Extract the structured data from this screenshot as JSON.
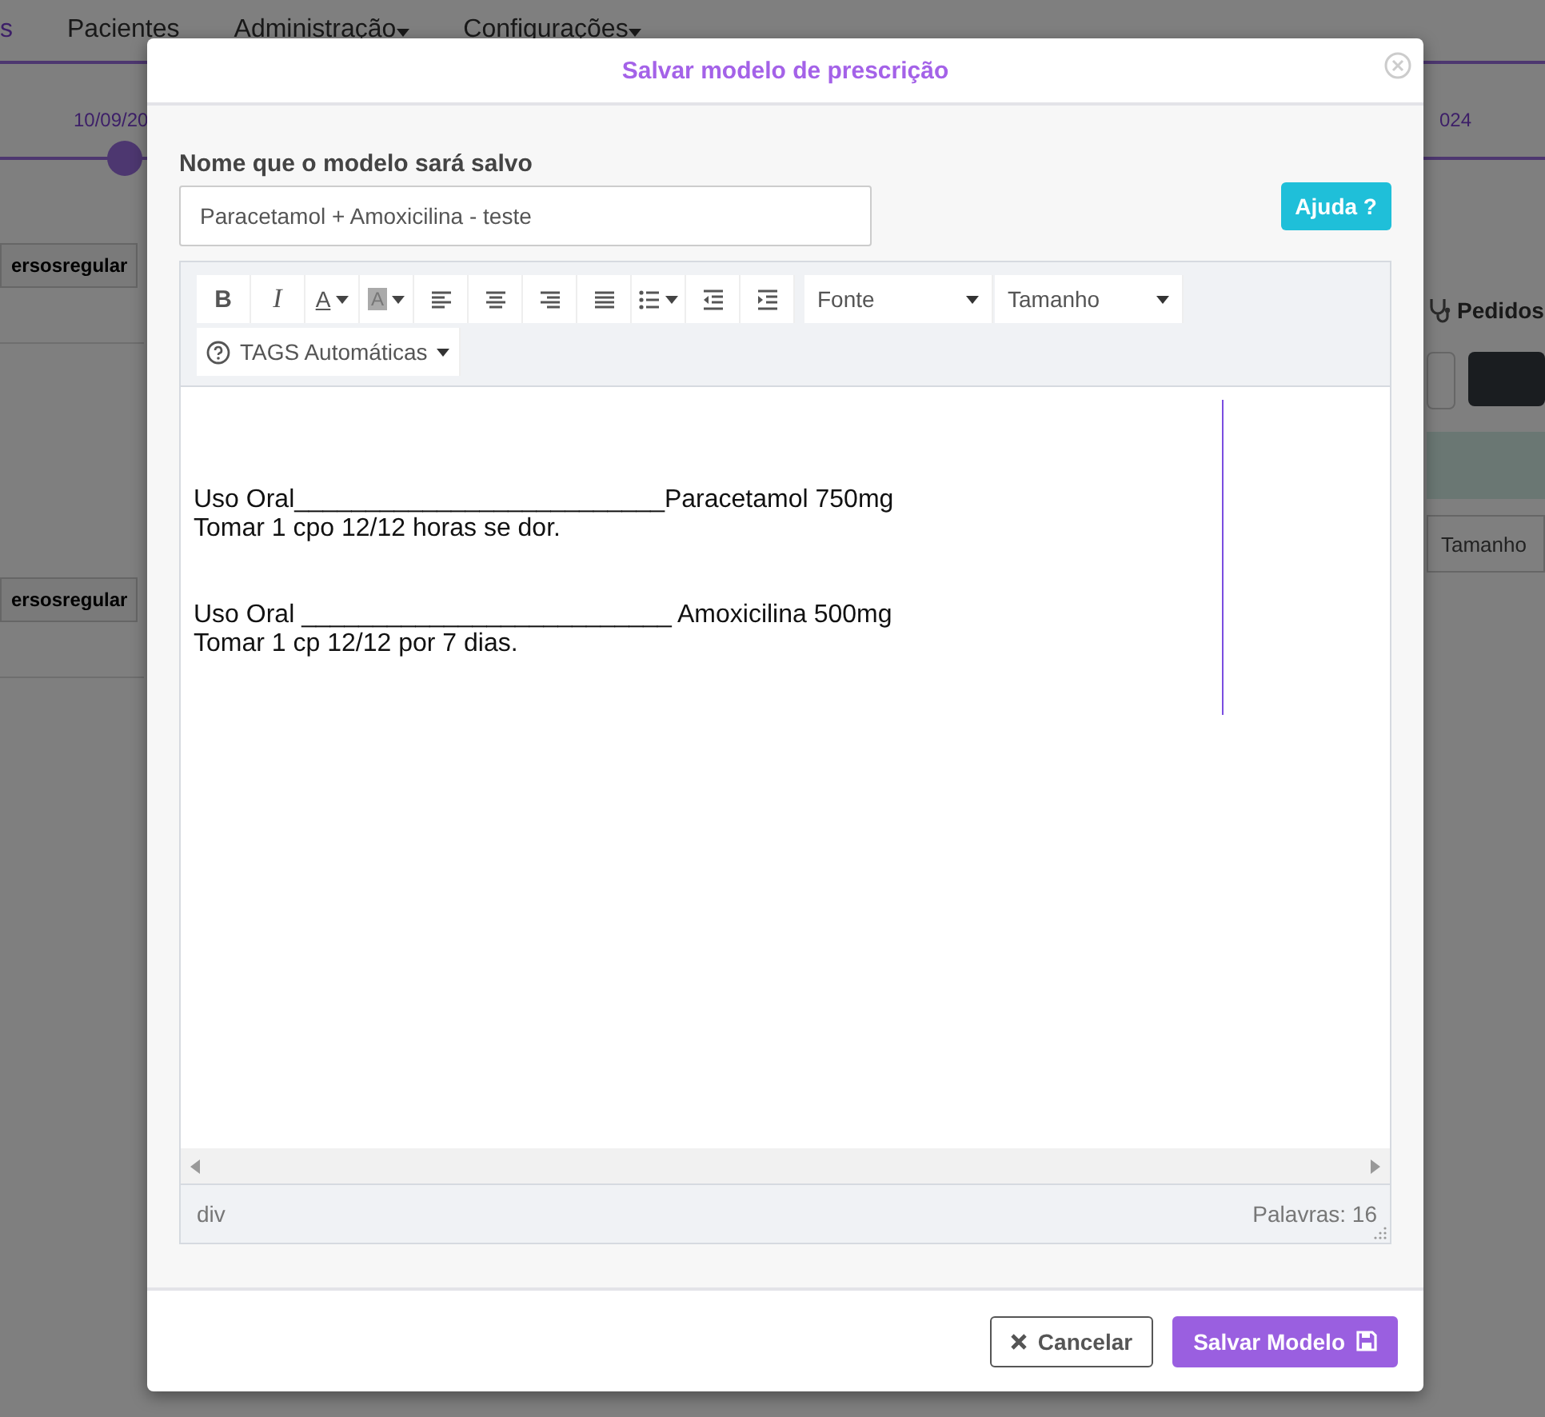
{
  "background_page": {
    "nav": [
      {
        "label": "s",
        "caret": false
      },
      {
        "label": "Pacientes",
        "caret": false
      },
      {
        "label": "Administração",
        "caret": true
      },
      {
        "label": "Configurações",
        "caret": true
      }
    ],
    "timeline": {
      "start_date": "10/09/20",
      "end_date": "024"
    },
    "left_buttons": [
      "ersosregular",
      "ersosregular"
    ],
    "right_panel": {
      "title": "Pedidos",
      "size_select": "Tamanho"
    }
  },
  "modal": {
    "title": "Salvar modelo de prescrição",
    "name_label": "Nome que o modelo sará salvo",
    "name_value": "Paracetamol + Amoxicilina - teste",
    "help_button": "Ajuda ?",
    "toolbar": [
      {
        "kind": "bold",
        "label": "B"
      },
      {
        "kind": "italic",
        "label": "I"
      },
      {
        "kind": "font-color",
        "label": "A"
      },
      {
        "kind": "highlight",
        "label": "A"
      },
      {
        "kind": "align-left"
      },
      {
        "kind": "align-center"
      },
      {
        "kind": "align-right"
      },
      {
        "kind": "justify"
      },
      {
        "kind": "list"
      },
      {
        "kind": "outdent"
      },
      {
        "kind": "indent"
      },
      {
        "kind": "select",
        "label": "Fonte"
      },
      {
        "kind": "select",
        "label": "Tamanho"
      },
      {
        "kind": "tags",
        "label": "TAGS Automáticas"
      }
    ],
    "paragraphs": [
      [
        "Uso Oral__________________________Paracetamol 750mg",
        "Tomar 1 cpo 12/12 horas se dor."
      ],
      [
        "Uso Oral __________________________ Amoxicilina 500mg",
        "Tomar 1 cp 12/12 por 7 dias."
      ]
    ],
    "status_path": "div",
    "word_count": "Palavras: 16",
    "buttons": [
      {
        "kind": "cancel",
        "label": "Cancelar"
      },
      {
        "kind": "save",
        "label": "Salvar Modelo"
      }
    ]
  }
}
